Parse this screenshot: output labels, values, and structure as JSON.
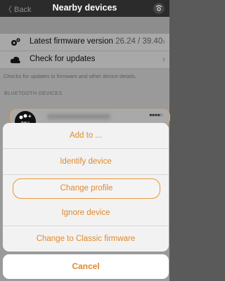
{
  "nav": {
    "back_label": "〈 Back",
    "title": "Nearby devices",
    "device_icon": "device-wave-icon"
  },
  "settings": {
    "firmware_label": "Latest firmware version",
    "firmware_value": "26.24 / 39.40",
    "check_updates_label": "Check for updates",
    "hint": "Checks for updates in firmware and other device details."
  },
  "section_header": "BLUETOOTH DEVICES",
  "device": {
    "badge_text": "DALI",
    "signal_dots": "●●●●○",
    "status_color": "#e0a25b"
  },
  "action_sheet": {
    "items": [
      {
        "label": "Add to ..."
      },
      {
        "label": "Identify device"
      },
      {
        "label": "Change profile"
      },
      {
        "label": "Ignore device"
      },
      {
        "label": "Change to Classic firmware"
      }
    ],
    "cancel_label": "Cancel"
  },
  "colors": {
    "accent": "#e08a2e",
    "nav_bg": "#2b2b2b"
  }
}
